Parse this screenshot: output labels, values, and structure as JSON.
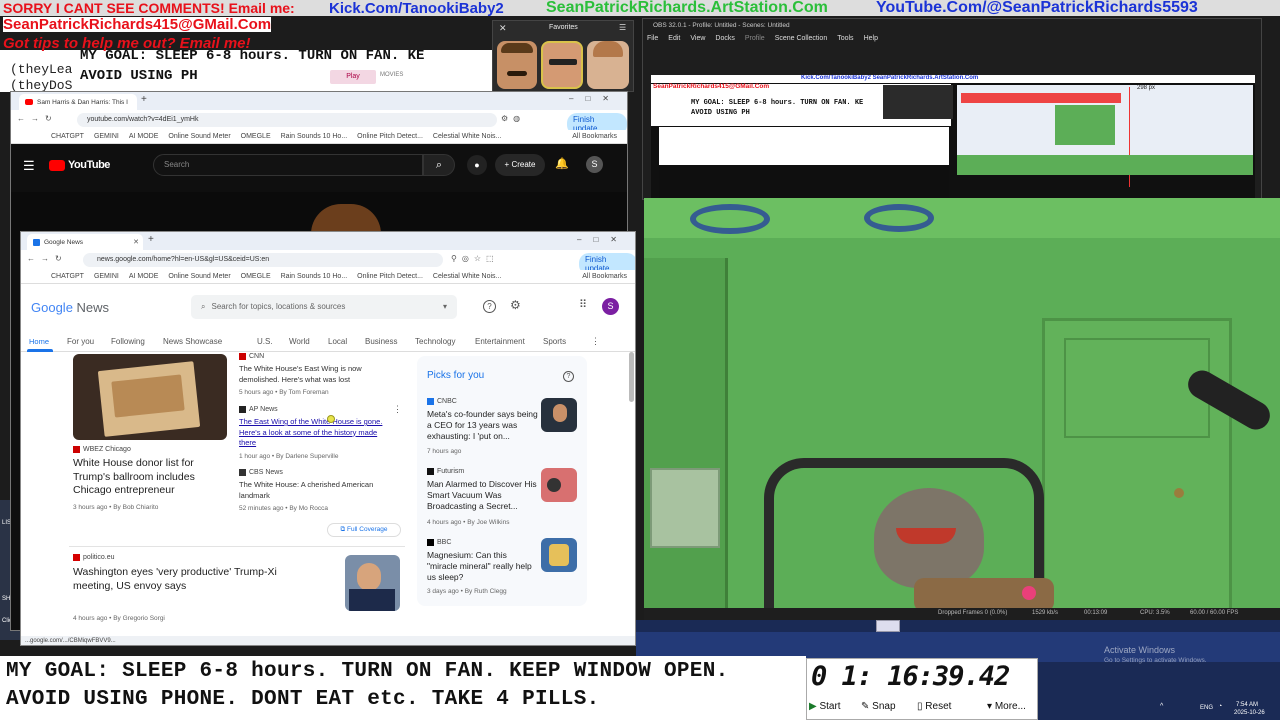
{
  "overlay": {
    "comments_line": "SORRY I CANT SEE COMMENTS! Email me:",
    "kick": "Kick.Com/TanookiBaby2",
    "artstation": "SeanPatrickRichards.ArtStation.Com",
    "youtube_link": "YouTube.Com/@SeanPatrickRichards5593",
    "email": "SeanPatrickRichards415@GMail.Com",
    "tips": "Got tips to help me out? Email me!",
    "goal_small_1": "MY GOAL: SLEEP 6-8 hours. TURN ON FAN. KE",
    "goal_small_2": "AVOID USING PH",
    "goal_line1": "MY GOAL: SLEEP 6-8 hours. TURN ON FAN. KEEP WINDOW OPEN.",
    "goal_line2": "AVOID USING PHONE. DONT EAT etc. TAKE 4 PILLS.",
    "bg_frag_1": "(theyLea",
    "bg_frag_2": "(theyDoS",
    "play_label": "Play",
    "movies_label": "MOVIES"
  },
  "favorites": {
    "title": "Favorites",
    "close": "✕",
    "menu": "☰"
  },
  "youtube_window": {
    "tab_title": "Sam Harris & Dan Harris: This I",
    "url": "youtube.com/watch?v=4dEi1_ymHk",
    "search_placeholder": "Search",
    "create_label": "Create",
    "logo_text": "YouTube",
    "avatar_letter": "S",
    "finish_update": "Finish update",
    "all_bookmarks": "All Bookmarks",
    "bookmarks": [
      "CHATGPT",
      "GEMINI",
      "AI MODE",
      "Online Sound Meter",
      "OMEGLE",
      "Rain Sounds 10 Ho...",
      "Online Pitch Detect...",
      "Celestial White Nois..."
    ]
  },
  "news_window": {
    "tab_title": "Google News",
    "url": "news.google.com/home?hl=en-US&gl=US&ceid=US:en",
    "finish_update": "Finish update",
    "all_bookmarks": "All Bookmarks",
    "bookmarks": [
      "CHATGPT",
      "GEMINI",
      "AI MODE",
      "Online Sound Meter",
      "OMEGLE",
      "Rain Sounds 10 Ho...",
      "Online Pitch Detect...",
      "Celestial White Nois..."
    ],
    "logo_google": "Google",
    "logo_news": "News",
    "search_placeholder": "Search for topics, locations & sources",
    "avatar_letter": "S",
    "nav": [
      "Home",
      "For you",
      "Following",
      "News Showcase",
      "U.S.",
      "World",
      "Local",
      "Business",
      "Technology",
      "Entertainment",
      "Sports"
    ],
    "story1": {
      "source": "WBEZ Chicago",
      "headline": "White House donor list for Trump's ballroom includes Chicago entrepreneur",
      "meta": "3 hours ago • By Bob Chiarito"
    },
    "related": [
      {
        "source": "CNN",
        "headline": "The White House's East Wing is now demolished. Here's what was lost",
        "meta": "5 hours ago • By Tom Foreman"
      },
      {
        "source": "AP News",
        "headline": "The East Wing of the White House is gone. Here's a look at some of the history made there",
        "meta": "1 hour ago • By Darlene Superville"
      },
      {
        "source": "CBS News",
        "headline": "The White House: A cherished American landmark",
        "meta": "52 minutes ago • By Mo Rocca"
      }
    ],
    "full_coverage": "Full Coverage",
    "story2": {
      "source": "politico.eu",
      "headline": "Washington eyes 'very productive' Trump-Xi meeting, US envoy says",
      "meta": "4 hours ago • By Gregorio Sorgi"
    },
    "picks_title": "Picks for you",
    "picks": [
      {
        "source": "CNBC",
        "headline": "Meta's co-founder says being a CEO for 13 years was exhausting: I 'put on...",
        "meta": "7 hours ago"
      },
      {
        "source": "Futurism",
        "headline": "Man Alarmed to Discover His Smart Vacuum Was Broadcasting a Secret...",
        "meta": "4 hours ago • By Joe Wilkins"
      },
      {
        "source": "BBC",
        "headline": "Magnesium: Can this \"miracle mineral\" really help us sleep?",
        "meta": "3 days ago • By Ruth Clegg"
      }
    ],
    "status_url": "...google.com/.../CBMiqwFBVV9..."
  },
  "obs": {
    "title": "OBS 32.0.1 - Profile: Untitled - Scenes: Untitled",
    "menu": [
      "File",
      "Edit",
      "View",
      "Docks",
      "Profile",
      "Scene Collection",
      "Tools",
      "Help"
    ],
    "status_dropped": "Dropped Frames 0 (0.0%)",
    "status_kbps": "1529 kb/s",
    "status_time": "00:13:09",
    "status_cpu": "CPU: 3.5%",
    "status_fps": "60.00 / 60.00 FPS",
    "px_label": "298 px"
  },
  "stopwatch": {
    "time": "0 1: 16:39.42",
    "start": "Start",
    "snap": "Snap",
    "reset": "Reset",
    "more": "More..."
  },
  "windows": {
    "activate_title": "Activate Windows",
    "activate_sub": "Go to Settings to activate Windows.",
    "lang": "ENG",
    "clock_time": "7:54 AM",
    "clock_date": "2025-10-26"
  },
  "desktop_icons": [
    "LIST_O",
    "SHP",
    "Click_"
  ],
  "colors": {
    "overlay_red": "#e8111b",
    "overlay_blue": "#1b33d6",
    "wall_green": "#5cae57",
    "news_blue": "#1a73e8"
  }
}
